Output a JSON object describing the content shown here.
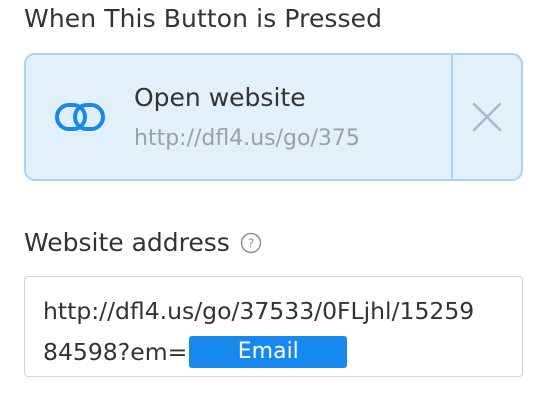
{
  "section": {
    "title": "When This Button is Pressed"
  },
  "action": {
    "icon": "link-icon",
    "title": "Open website",
    "url_preview": "http://dfl4.us/go/375",
    "remove_icon": "close-icon"
  },
  "website": {
    "label": "Website address",
    "help_icon": "help-icon",
    "value_line1": "http://dfl4.us/go/37533/0FLjhl/15259",
    "value_line2": "84598?em=",
    "token_label": "Email"
  },
  "colors": {
    "card_bg": "#e1f0fb",
    "card_border": "#a9d3f2",
    "accent": "#1589ee",
    "muted_text": "#9aa1a8"
  }
}
